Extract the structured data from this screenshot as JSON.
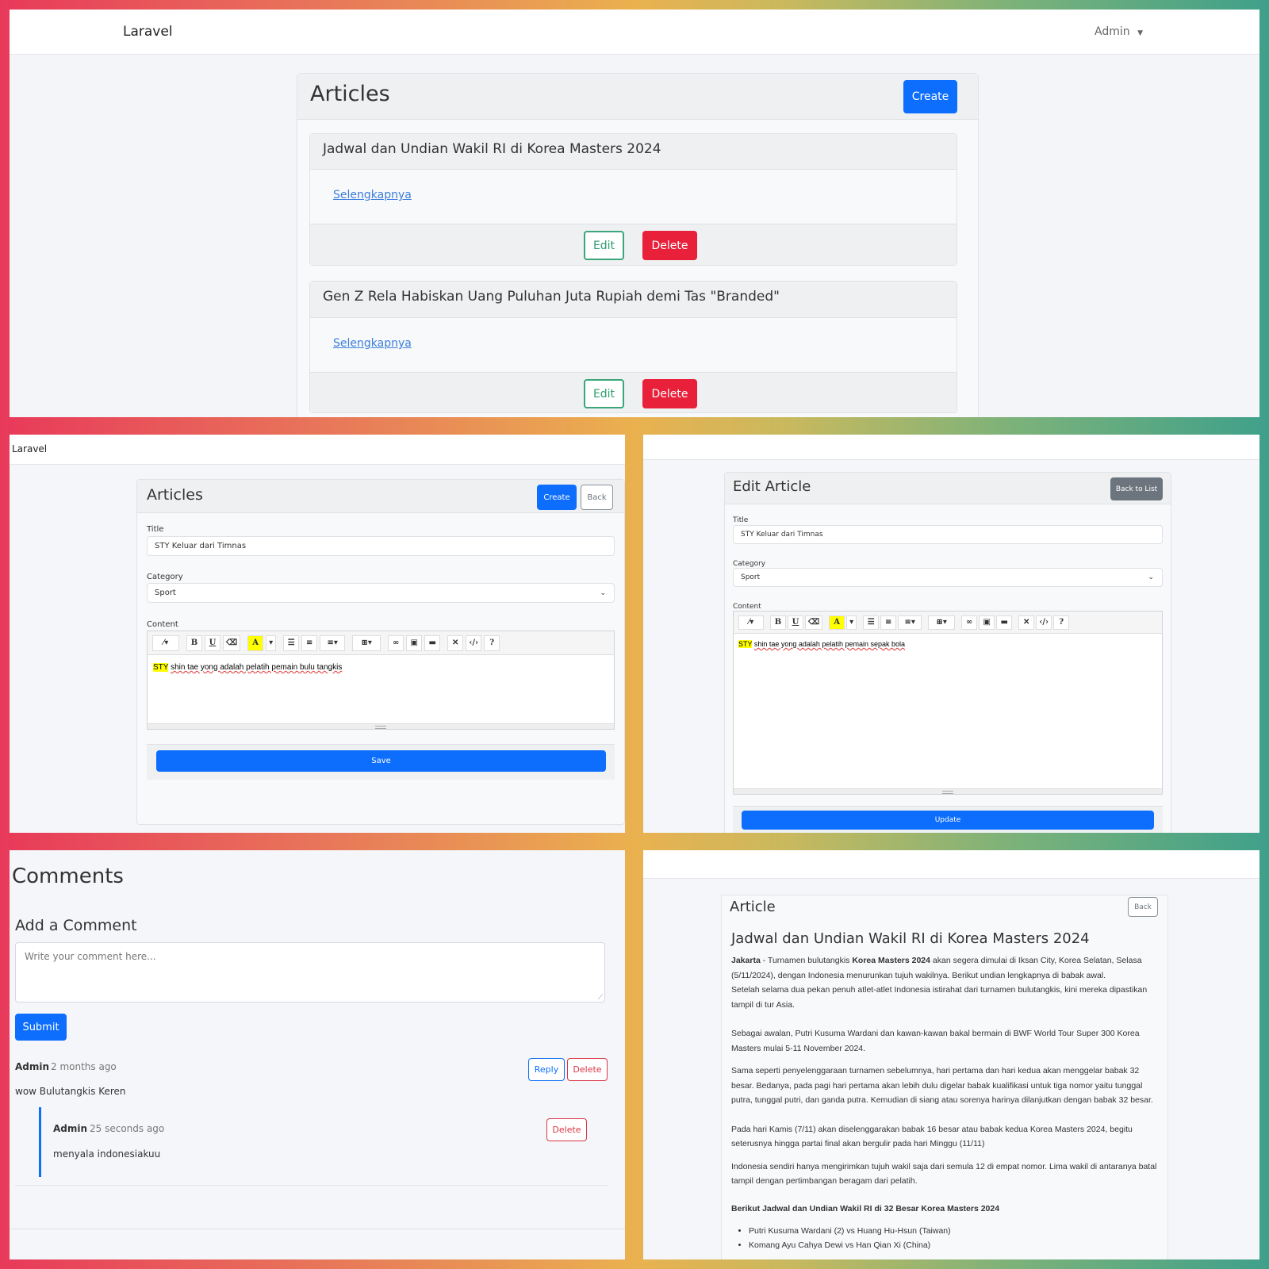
{
  "brand": "Laravel",
  "admin_menu": "Admin",
  "list_view": {
    "title": "Articles",
    "create_label": "Create",
    "articles": [
      {
        "title": "Jadwal dan Undian Wakil RI di Korea Masters 2024",
        "link": "Selengkapnya",
        "edit": "Edit",
        "delete": "Delete"
      },
      {
        "title": "Gen Z Rela Habiskan Uang Puluhan Juta Rupiah demi Tas \"Branded\"",
        "link": "Selengkapnya",
        "edit": "Edit",
        "delete": "Delete"
      }
    ]
  },
  "create_view": {
    "title": "Articles",
    "create_label": "Create",
    "back_label": "Back",
    "title_label": "Title",
    "title_value": "STY Keluar dari Timnas",
    "category_label": "Category",
    "category_value": "Sport",
    "content_label": "Content",
    "content_highlight": "STY",
    "content_rest": "shin tae yong adalah pelatih pemain bulu tangkis",
    "save_label": "Save"
  },
  "edit_view": {
    "title": "Edit Article",
    "back_label": "Back to List",
    "title_label": "Title",
    "title_value": "STY Keluar dari Timnas",
    "category_label": "Category",
    "category_value": "Sport",
    "content_label": "Content",
    "content_highlight": "STY",
    "content_rest": "shin tae yong adalah pelatih pemain sepak bola",
    "update_label": "Update"
  },
  "comments_view": {
    "heading": "Comments",
    "add_heading": "Add a Comment",
    "placeholder": "Write your comment here...",
    "submit_label": "Submit",
    "comments": [
      {
        "author": "Admin",
        "time": "2 months ago",
        "text": "wow Bulutangkis Keren",
        "reply": "Reply",
        "delete": "Delete"
      }
    ],
    "reply": {
      "author": "Admin",
      "time": "25 seconds ago",
      "text": "menyala indonesiakuu",
      "delete": "Delete"
    }
  },
  "article_view": {
    "header": "Article",
    "back_label": "Back",
    "title": "Jadwal dan Undian Wakil RI di Korea Masters 2024",
    "p1_b1": "Jakarta",
    "p1_t1": " - Turnamen bulutangkis ",
    "p1_b2": "Korea Masters 2024",
    "p1_t2": " akan segera dimulai di Iksan City, Korea Selatan, Selasa (5/11/2024), dengan Indonesia menurunkan tujuh wakilnya. Berikut undian lengkapnya di babak awal.",
    "p2": "Setelah selama dua pekan penuh atlet-atlet Indonesia istirahat dari turnamen bulutangkis, kini mereka dipastikan tampil di tur Asia.",
    "p3": "Sebagai awalan, Putri Kusuma Wardani dan kawan-kawan bakal bermain di BWF World Tour Super 300 Korea Masters mulai 5-11 November 2024.",
    "p4": "Sama seperti penyelenggaraan turnamen sebelumnya, hari pertama dan hari kedua akan menggelar babak 32 besar. Bedanya, pada pagi hari pertama akan lebih dulu digelar babak kualifikasi untuk tiga nomor yaitu tunggal putra, tunggal putri, dan ganda putra. Kemudian di siang atau sorenya harinya dilanjutkan dengan babak 32 besar.",
    "p5": "Pada hari Kamis (7/11) akan diselenggarakan babak 16 besar atau babak kedua Korea Masters 2024, begitu seterusnya hingga partai final akan bergulir pada hari Minggu (11/11)",
    "p6": "Indonesia sendiri hanya mengirimkan tujuh wakil saja dari semula 12 di empat nomor. Lima wakil di antaranya batal tampil dengan pertimbangan beragam dari pelatih.",
    "schedule_heading": "Berikut Jadwal dan Undian Wakil RI di 32 Besar Korea Masters 2024",
    "schedule": [
      "Putri Kusuma Wardani (2) vs Huang Hu-Hsun (Taiwan)",
      "Komang Ayu Cahya Dewi vs Han Qian Xi (China)"
    ]
  },
  "icons": [
    "magic-icon",
    "bold-icon",
    "underline-icon",
    "eraser-icon",
    "color-icon",
    "ul-icon",
    "ol-icon",
    "align-icon",
    "table-icon",
    "link-icon",
    "picture-icon",
    "video-icon",
    "fullscreen-icon",
    "code-icon",
    "help-icon",
    "caret-down-icon"
  ],
  "colors": {
    "primary": "#0d6efd",
    "danger": "#e8203a",
    "success": "#3aa679"
  }
}
